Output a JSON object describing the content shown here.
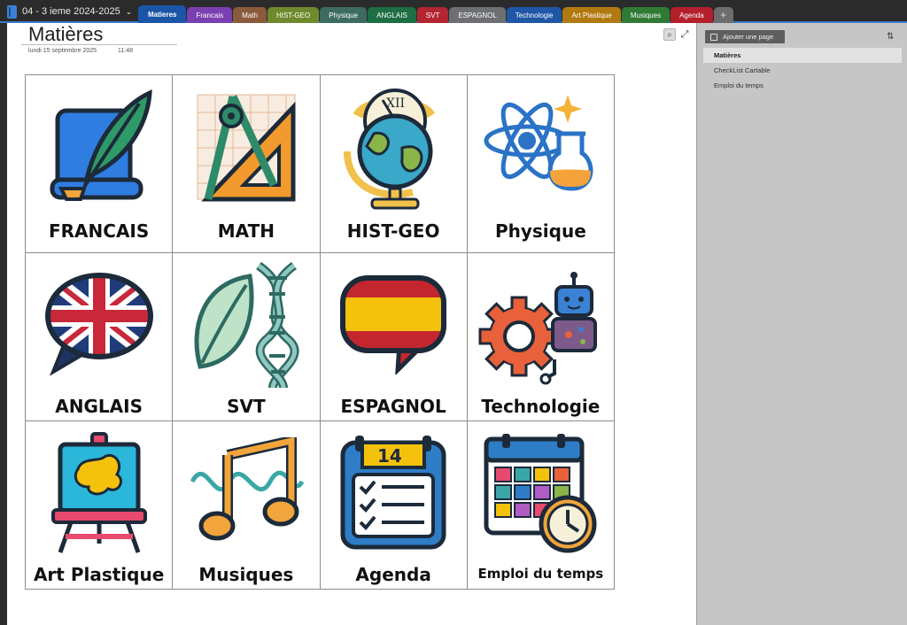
{
  "notebook": {
    "name": "04 - 3 ieme 2024-2025",
    "icon": "notebook-icon"
  },
  "sections": [
    {
      "label": "Matieres",
      "color": "#1a55a8",
      "active": true
    },
    {
      "label": "Francais",
      "color": "#7a3fb0"
    },
    {
      "label": "Math",
      "color": "#8a5a3c"
    },
    {
      "label": "HIST-GEO",
      "color": "#6f8a2c"
    },
    {
      "label": "Physique",
      "color": "#3d6b5f"
    },
    {
      "label": "ANGLAIS",
      "color": "#1e6e43"
    },
    {
      "label": "SVT",
      "color": "#b32631"
    },
    {
      "label": "ESPAGNOL",
      "color": "#6d6f73"
    },
    {
      "label": "Technologie",
      "color": "#1f57a6"
    },
    {
      "label": "Art Plastique",
      "color": "#b07a10"
    },
    {
      "label": "Musiques",
      "color": "#2f7a35"
    },
    {
      "label": "Agenda",
      "color": "#b3202b"
    }
  ],
  "add_section_label": "+",
  "page": {
    "title": "Matières",
    "date": "lundi 15 septembre 2025",
    "time": "11:48",
    "tools": {
      "search_icon": "search-icon",
      "expand_icon": "expand-icon"
    }
  },
  "subjects": [
    {
      "label": "FRANCAIS",
      "icon": "quill-scroll-icon"
    },
    {
      "label": "MATH",
      "icon": "compass-ruler-icon"
    },
    {
      "label": "HIST-GEO",
      "icon": "globe-clock-icon"
    },
    {
      "label": "Physique",
      "icon": "atom-flask-icon"
    },
    {
      "label": "ANGLAIS",
      "icon": "uk-flag-bubble-icon"
    },
    {
      "label": "SVT",
      "icon": "leaf-dna-icon"
    },
    {
      "label": "ESPAGNOL",
      "icon": "spain-flag-bubble-icon"
    },
    {
      "label": "Technologie",
      "icon": "gear-robot-icon"
    },
    {
      "label": "Art Plastique",
      "icon": "easel-icon"
    },
    {
      "label": "Musiques",
      "icon": "music-note-icon"
    },
    {
      "label": "Agenda",
      "icon": "calendar-checklist-icon"
    },
    {
      "label": "Emploi du temps",
      "icon": "timetable-clock-icon"
    }
  ],
  "sidebar": {
    "add_page_label": "Ajouter une page",
    "sort_icon": "sort-icon",
    "pages": [
      {
        "label": "Matières",
        "selected": true
      },
      {
        "label": "CheckList Cartable"
      },
      {
        "label": "Emploi du temps"
      }
    ]
  }
}
